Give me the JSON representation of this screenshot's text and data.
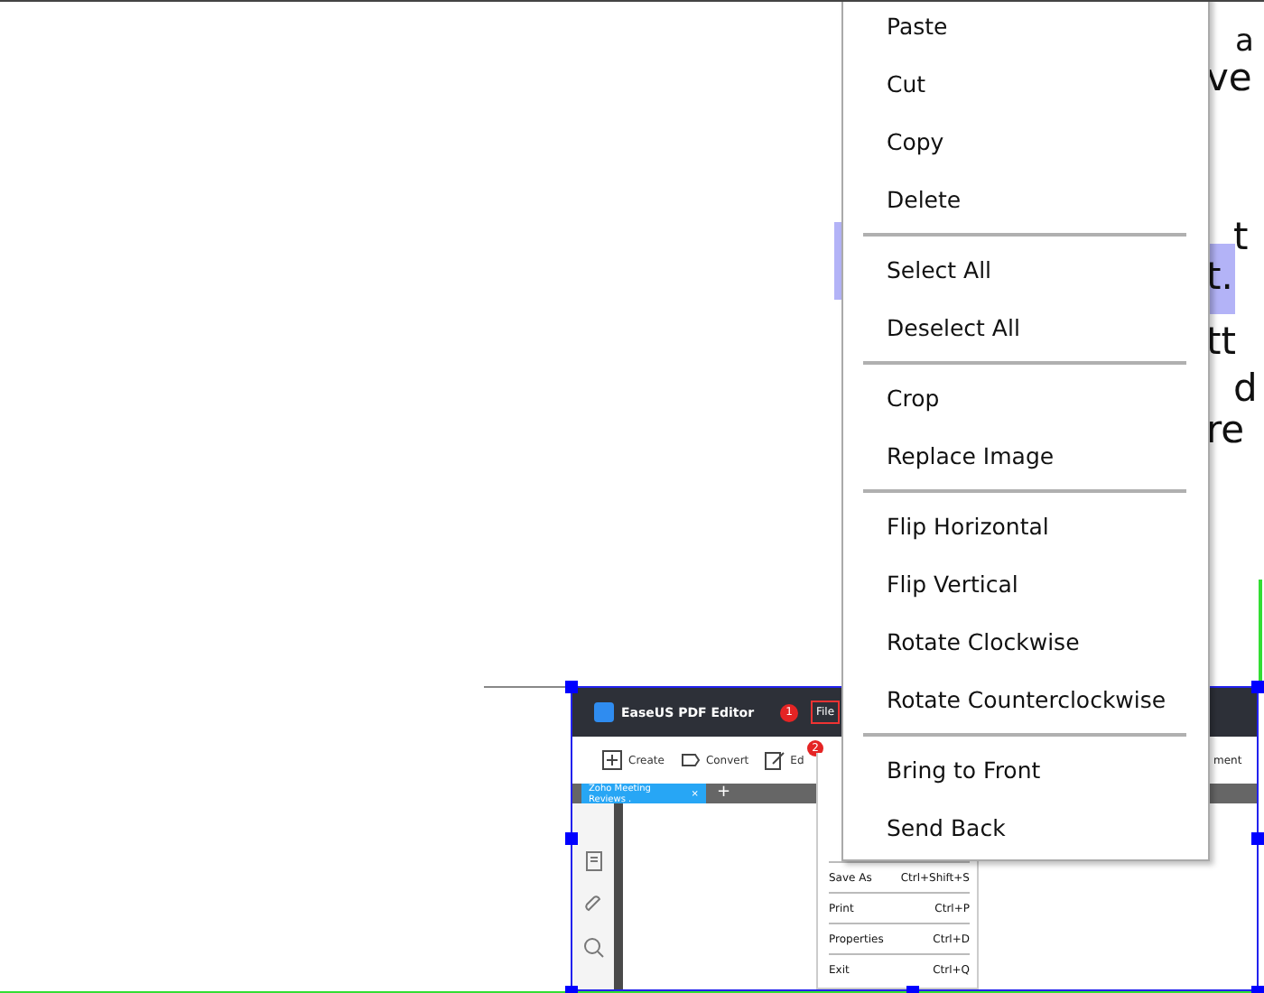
{
  "document": {
    "fragments": [
      {
        "text": "a",
        "kind": "raised"
      },
      {
        "text": "ve",
        "kind": "plain"
      },
      {
        "text": "t",
        "kind": "plain"
      },
      {
        "text": "t.",
        "kind": "highlighted"
      },
      {
        "text": "tt",
        "kind": "plain"
      },
      {
        "text": "d",
        "kind": "plain"
      },
      {
        "text": "re",
        "kind": "plain"
      }
    ]
  },
  "embedded_screenshot": {
    "title": "EaseUS PDF Editor",
    "badge_1": "1",
    "file_menu": "File",
    "toolbar": [
      {
        "label": "Create",
        "kind": "create"
      },
      {
        "label": "Convert",
        "kind": "convert"
      },
      {
        "label": "Ed",
        "kind": "edit"
      }
    ],
    "badge_2": "2",
    "toolbar_right": "ment",
    "tab": {
      "label": "Zoho Meeting Reviews .",
      "close": "×"
    },
    "add_tab": "+",
    "file_items": [
      {
        "label": "Save As",
        "shortcut": "Ctrl+Shift+S"
      },
      {
        "label": "Print",
        "shortcut": "Ctrl+P"
      },
      {
        "label": "Properties",
        "shortcut": "Ctrl+D"
      },
      {
        "label": "Exit",
        "shortcut": "Ctrl+Q"
      }
    ]
  },
  "context_menu": {
    "items": [
      {
        "label": "Paste",
        "divider_after": false
      },
      {
        "label": "Cut",
        "divider_after": false
      },
      {
        "label": "Copy",
        "divider_after": false
      },
      {
        "label": "Delete",
        "divider_after": true
      },
      {
        "label": "Select All",
        "divider_after": false
      },
      {
        "label": "Deselect All",
        "divider_after": true
      },
      {
        "label": "Crop",
        "divider_after": false
      },
      {
        "label": "Replace Image",
        "divider_after": true
      },
      {
        "label": "Flip Horizontal",
        "divider_after": false
      },
      {
        "label": "Flip Vertical",
        "divider_after": false
      },
      {
        "label": "Rotate Clockwise",
        "divider_after": false
      },
      {
        "label": "Rotate Counterclockwise",
        "divider_after": true
      },
      {
        "label": "Bring to Front",
        "divider_after": false
      },
      {
        "label": "Send Back",
        "divider_after": false
      }
    ]
  }
}
